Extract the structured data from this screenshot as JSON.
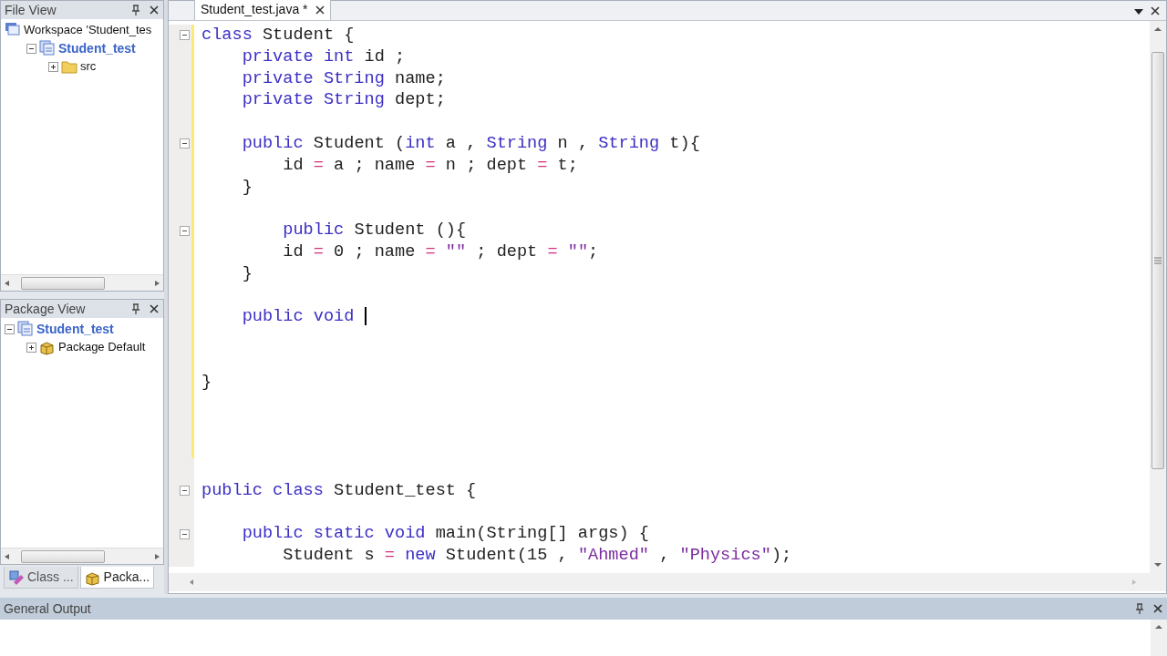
{
  "file_view": {
    "title": "File View",
    "tree": [
      {
        "label": "Workspace 'Student_tes",
        "kind": "workspace",
        "active": false,
        "children": [
          {
            "label": "Student_test",
            "kind": "project",
            "active": true,
            "expanded": true,
            "children": [
              {
                "label": "src",
                "kind": "folder",
                "active": false,
                "expanded": false
              }
            ]
          }
        ]
      }
    ]
  },
  "package_view": {
    "title": "Package View",
    "tree": [
      {
        "label": "Student_test",
        "kind": "project",
        "active": true,
        "expanded": true,
        "children": [
          {
            "label": "Package Default",
            "kind": "package",
            "active": false,
            "expanded": false
          }
        ]
      }
    ]
  },
  "side_tabs": [
    {
      "label": "Class ...",
      "kind": "class",
      "selected": false
    },
    {
      "label": "Packa...",
      "kind": "package",
      "selected": true
    }
  ],
  "editor": {
    "tabs": [
      {
        "label": "Student_test.java *",
        "selected": true
      }
    ],
    "lines": [
      {
        "fold": true,
        "modified": true,
        "tokens": [
          {
            "kind": "kw",
            "text": "class"
          },
          {
            "kind": "tx",
            "text": " Student {"
          }
        ]
      },
      {
        "modified": true,
        "tokens": [
          {
            "kind": "kw",
            "text": "    private int"
          },
          {
            "kind": "tx",
            "text": " id ;"
          }
        ]
      },
      {
        "modified": true,
        "tokens": [
          {
            "kind": "kw",
            "text": "    private String"
          },
          {
            "kind": "tx",
            "text": " name;"
          }
        ]
      },
      {
        "modified": true,
        "tokens": [
          {
            "kind": "kw",
            "text": "    private String"
          },
          {
            "kind": "tx",
            "text": " dept;"
          }
        ]
      },
      {
        "modified": true
      },
      {
        "fold": true,
        "modified": true,
        "tokens": [
          {
            "kind": "kw",
            "text": "    public"
          },
          {
            "kind": "tx",
            "text": " Student ("
          },
          {
            "kind": "kw",
            "text": "int"
          },
          {
            "kind": "tx",
            "text": " a , "
          },
          {
            "kind": "kw",
            "text": "String"
          },
          {
            "kind": "tx",
            "text": " n , "
          },
          {
            "kind": "kw",
            "text": "String"
          },
          {
            "kind": "tx",
            "text": " t){"
          }
        ]
      },
      {
        "modified": true,
        "tokens": [
          {
            "kind": "tx",
            "text": "        id "
          },
          {
            "kind": "op",
            "text": "="
          },
          {
            "kind": "tx",
            "text": " a ; name "
          },
          {
            "kind": "op",
            "text": "="
          },
          {
            "kind": "tx",
            "text": " n ; dept "
          },
          {
            "kind": "op",
            "text": "="
          },
          {
            "kind": "tx",
            "text": " t;"
          }
        ]
      },
      {
        "modified": true,
        "tokens": [
          {
            "kind": "tx",
            "text": "    }"
          }
        ]
      },
      {
        "modified": true
      },
      {
        "fold": true,
        "modified": true,
        "tokens": [
          {
            "kind": "kw",
            "text": "        public"
          },
          {
            "kind": "tx",
            "text": " Student (){"
          }
        ]
      },
      {
        "modified": true,
        "tokens": [
          {
            "kind": "tx",
            "text": "        id "
          },
          {
            "kind": "op",
            "text": "="
          },
          {
            "kind": "tx",
            "text": " 0 ; name "
          },
          {
            "kind": "op",
            "text": "="
          },
          {
            "kind": "str",
            "text": " \"\""
          },
          {
            "kind": "tx",
            "text": " ; dept "
          },
          {
            "kind": "op",
            "text": "="
          },
          {
            "kind": "str",
            "text": " \"\""
          },
          {
            "kind": "tx",
            "text": ";"
          }
        ]
      },
      {
        "modified": true,
        "tokens": [
          {
            "kind": "tx",
            "text": "    }"
          }
        ]
      },
      {
        "modified": true
      },
      {
        "modified": true,
        "caret": true,
        "tokens": [
          {
            "kind": "kw",
            "text": "    public void "
          }
        ]
      },
      {
        "modified": true
      },
      {
        "modified": true
      },
      {
        "modified": true,
        "tokens": [
          {
            "kind": "tx",
            "text": "}"
          }
        ]
      },
      {
        "modified": true
      },
      {
        "modified": true
      },
      {
        "modified": true
      },
      {
        "modified": false
      },
      {
        "fold": true,
        "tokens": [
          {
            "kind": "kw",
            "text": "public class"
          },
          {
            "kind": "tx",
            "text": " Student_test {"
          }
        ]
      },
      {
        "modified": false
      },
      {
        "fold": true,
        "tokens": [
          {
            "kind": "kw",
            "text": "    public static void"
          },
          {
            "kind": "tx",
            "text": " main(String[] args) {"
          }
        ]
      },
      {
        "tokens": [
          {
            "kind": "tx",
            "text": "        Student s "
          },
          {
            "kind": "op",
            "text": "="
          },
          {
            "kind": "kw",
            "text": " new"
          },
          {
            "kind": "tx",
            "text": " Student(15 , "
          },
          {
            "kind": "str",
            "text": "\"Ahmed\""
          },
          {
            "kind": "tx",
            "text": " , "
          },
          {
            "kind": "str",
            "text": "\"Physics\""
          },
          {
            "kind": "tx",
            "text": ");"
          }
        ]
      }
    ]
  },
  "output": {
    "title": "General Output"
  }
}
